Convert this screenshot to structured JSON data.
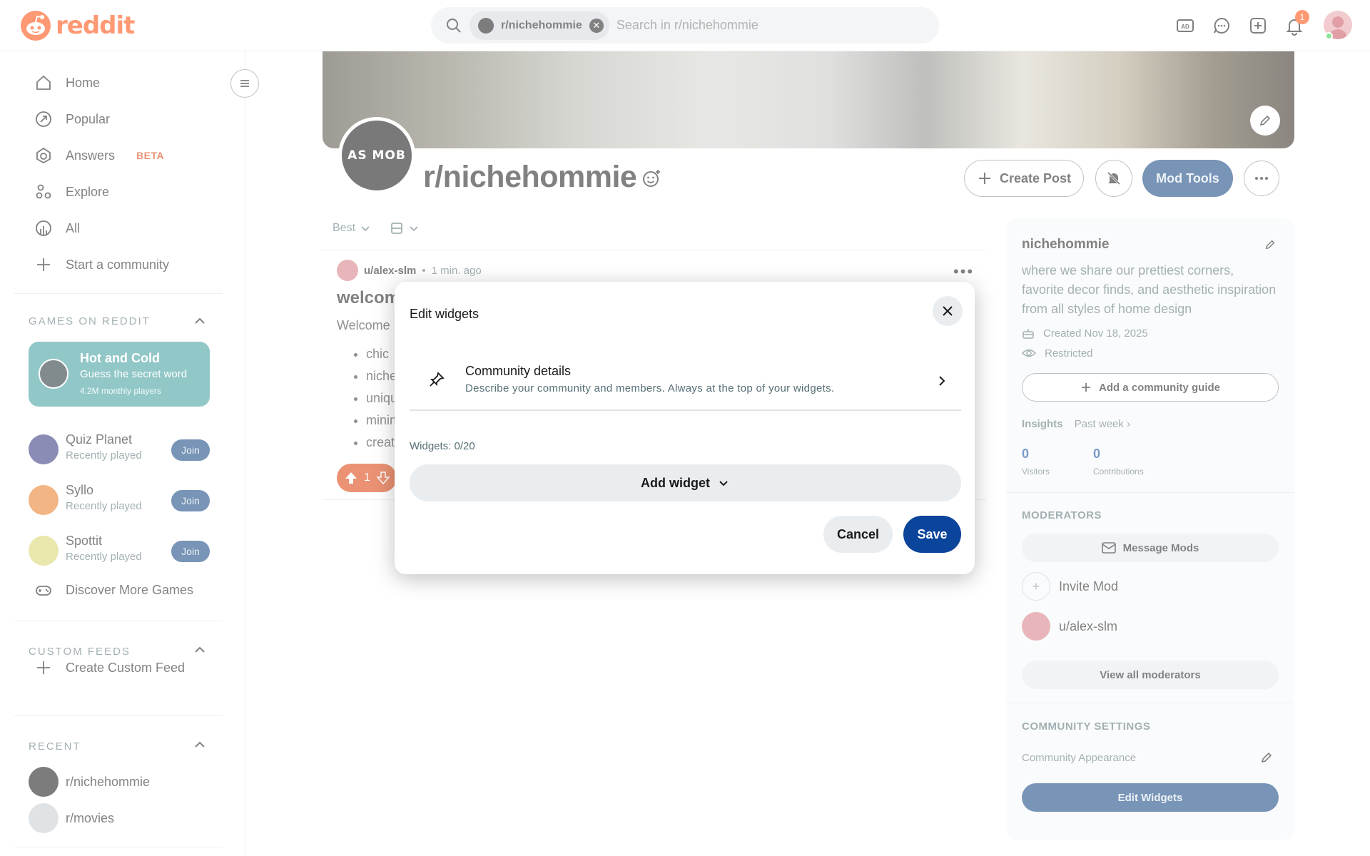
{
  "header": {
    "logo_text": "reddit",
    "search_chip": "r/nichehommie",
    "search_placeholder": "Search in r/nichehommie",
    "notification_count": "1"
  },
  "sidebar": {
    "main_items": [
      {
        "label": "Home",
        "icon": "home-icon"
      },
      {
        "label": "Popular",
        "icon": "popular-icon"
      },
      {
        "label": "Answers",
        "icon": "answers-icon",
        "badge": "BETA"
      },
      {
        "label": "Explore",
        "icon": "explore-icon"
      },
      {
        "label": "All",
        "icon": "all-icon"
      },
      {
        "label": "Start a community",
        "icon": "plus-icon"
      }
    ],
    "games_heading": "GAMES ON REDDIT",
    "featured_game": {
      "title": "Hot and Cold",
      "subtitle": "Guess the secret word",
      "meta": "4.2M monthly players"
    },
    "games": [
      {
        "name": "Quiz Planet",
        "status": "Recently played",
        "join": "Join"
      },
      {
        "name": "Syllo",
        "status": "Recently played",
        "join": "Join"
      },
      {
        "name": "Spottit",
        "status": "Recently played",
        "join": "Join"
      }
    ],
    "discover_games": "Discover More Games",
    "custom_feeds_heading": "CUSTOM FEEDS",
    "create_custom_feed": "Create Custom Feed",
    "recent_heading": "RECENT",
    "recent": [
      "r/nichehommie",
      "r/movies"
    ]
  },
  "community": {
    "avatar_text": "AS MOB",
    "name": "r/nichehommie",
    "create_post": "Create Post",
    "mod_tools": "Mod Tools",
    "sort_label": "Best"
  },
  "post": {
    "user": "u/alex-slm",
    "time": "1 min. ago",
    "title": "welcom",
    "body": "Welcome",
    "list": [
      "chic",
      "niche",
      "uniqu",
      "minim",
      "creat"
    ],
    "votes": "1"
  },
  "about": {
    "name": "nichehommie",
    "description": "where we share our prettiest corners, favorite decor finds, and aesthetic inspiration from all styles of home design",
    "created": "Created Nov 18, 2025",
    "visibility": "Restricted",
    "add_guide": "Add a community guide",
    "insights_label": "Insights",
    "insights_range": "Past week",
    "visitors_value": "0",
    "visitors_label": "Visitors",
    "contributions_value": "0",
    "contributions_label": "Contributions",
    "moderators_heading": "MODERATORS",
    "message_mods": "Message Mods",
    "invite_mod": "Invite Mod",
    "moderator": "u/alex-slm",
    "view_all_mods": "View all moderators",
    "settings_heading": "COMMUNITY SETTINGS",
    "appearance": "Community Appearance",
    "edit_widgets": "Edit Widgets"
  },
  "modal": {
    "title": "Edit widgets",
    "details_title": "Community details",
    "details_sub": "Describe your community and members. Always at the top of your widgets.",
    "widget_count": "Widgets: 0/20",
    "add_widget": "Add widget",
    "cancel": "Cancel",
    "save": "Save"
  },
  "colors": {
    "brand": "#ff4500",
    "primary_button": "#0a3d7b",
    "save_button": "#0a449b",
    "featured_game_bg": "#3a9a9b"
  }
}
